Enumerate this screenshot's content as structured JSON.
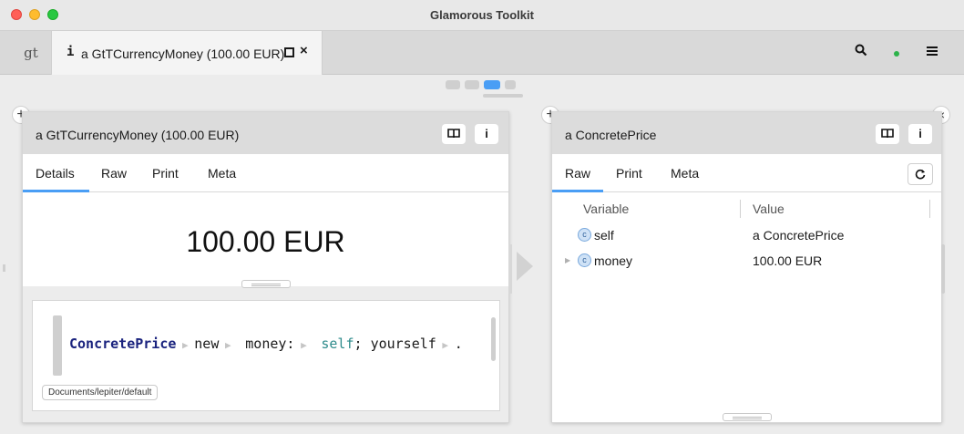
{
  "window": {
    "title": "Glamorous Toolkit"
  },
  "tabbar": {
    "gt_logo": "gt",
    "active_tab": {
      "icon": "i",
      "label": "a GtTCurrencyMoney (100.00 EUR)",
      "close": "×"
    },
    "search_icon": "search-icon",
    "menu_icon": "menu-icon"
  },
  "left_pane": {
    "title": "a GtTCurrencyMoney (100.00 EUR)",
    "book_icon": "book-icon",
    "info_label": "i",
    "tabs": [
      "Details",
      "Raw",
      "Print",
      "Meta"
    ],
    "active_tab": "Details",
    "display": "100.00 EUR",
    "snippet": {
      "code": {
        "class_name": "ConcretePrice",
        "send1": "new",
        "keyword": "money:",
        "arg": "self",
        "semicolon": ";",
        "send2": "yourself",
        "end": "."
      },
      "database": "Documents/lepiter/default"
    }
  },
  "right_pane": {
    "title": "a ConcretePrice",
    "book_icon": "book-icon",
    "info_label": "i",
    "tabs": [
      "Raw",
      "Print",
      "Meta"
    ],
    "active_tab": "Raw",
    "columns": [
      "Variable",
      "Value"
    ],
    "rows": [
      {
        "badge": "c",
        "variable": "self",
        "value": "a ConcretePrice",
        "expandable": false
      },
      {
        "badge": "c",
        "variable": "money",
        "value": "100.00 EUR",
        "expandable": true
      }
    ],
    "close": "×"
  },
  "plus_label": "+",
  "colors": {
    "accent": "#4a9ef5",
    "class": "#1a237e",
    "self": "#2e8b8b",
    "status": "#2db34a"
  }
}
